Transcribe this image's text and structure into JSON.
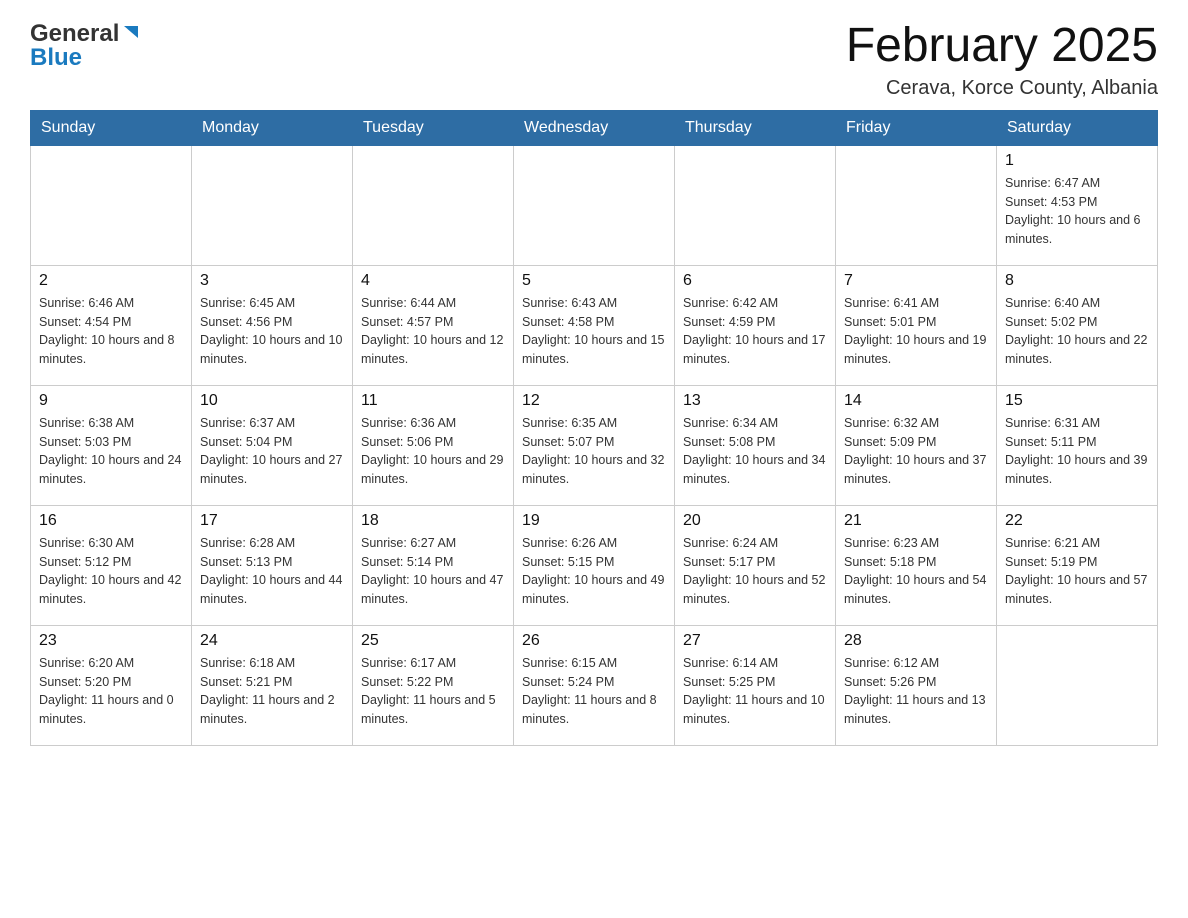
{
  "logo": {
    "general": "General",
    "blue": "Blue"
  },
  "title": "February 2025",
  "subtitle": "Cerava, Korce County, Albania",
  "days_of_week": [
    "Sunday",
    "Monday",
    "Tuesday",
    "Wednesday",
    "Thursday",
    "Friday",
    "Saturday"
  ],
  "weeks": [
    [
      {
        "day": "",
        "info": ""
      },
      {
        "day": "",
        "info": ""
      },
      {
        "day": "",
        "info": ""
      },
      {
        "day": "",
        "info": ""
      },
      {
        "day": "",
        "info": ""
      },
      {
        "day": "",
        "info": ""
      },
      {
        "day": "1",
        "info": "Sunrise: 6:47 AM\nSunset: 4:53 PM\nDaylight: 10 hours and 6 minutes."
      }
    ],
    [
      {
        "day": "2",
        "info": "Sunrise: 6:46 AM\nSunset: 4:54 PM\nDaylight: 10 hours and 8 minutes."
      },
      {
        "day": "3",
        "info": "Sunrise: 6:45 AM\nSunset: 4:56 PM\nDaylight: 10 hours and 10 minutes."
      },
      {
        "day": "4",
        "info": "Sunrise: 6:44 AM\nSunset: 4:57 PM\nDaylight: 10 hours and 12 minutes."
      },
      {
        "day": "5",
        "info": "Sunrise: 6:43 AM\nSunset: 4:58 PM\nDaylight: 10 hours and 15 minutes."
      },
      {
        "day": "6",
        "info": "Sunrise: 6:42 AM\nSunset: 4:59 PM\nDaylight: 10 hours and 17 minutes."
      },
      {
        "day": "7",
        "info": "Sunrise: 6:41 AM\nSunset: 5:01 PM\nDaylight: 10 hours and 19 minutes."
      },
      {
        "day": "8",
        "info": "Sunrise: 6:40 AM\nSunset: 5:02 PM\nDaylight: 10 hours and 22 minutes."
      }
    ],
    [
      {
        "day": "9",
        "info": "Sunrise: 6:38 AM\nSunset: 5:03 PM\nDaylight: 10 hours and 24 minutes."
      },
      {
        "day": "10",
        "info": "Sunrise: 6:37 AM\nSunset: 5:04 PM\nDaylight: 10 hours and 27 minutes."
      },
      {
        "day": "11",
        "info": "Sunrise: 6:36 AM\nSunset: 5:06 PM\nDaylight: 10 hours and 29 minutes."
      },
      {
        "day": "12",
        "info": "Sunrise: 6:35 AM\nSunset: 5:07 PM\nDaylight: 10 hours and 32 minutes."
      },
      {
        "day": "13",
        "info": "Sunrise: 6:34 AM\nSunset: 5:08 PM\nDaylight: 10 hours and 34 minutes."
      },
      {
        "day": "14",
        "info": "Sunrise: 6:32 AM\nSunset: 5:09 PM\nDaylight: 10 hours and 37 minutes."
      },
      {
        "day": "15",
        "info": "Sunrise: 6:31 AM\nSunset: 5:11 PM\nDaylight: 10 hours and 39 minutes."
      }
    ],
    [
      {
        "day": "16",
        "info": "Sunrise: 6:30 AM\nSunset: 5:12 PM\nDaylight: 10 hours and 42 minutes."
      },
      {
        "day": "17",
        "info": "Sunrise: 6:28 AM\nSunset: 5:13 PM\nDaylight: 10 hours and 44 minutes."
      },
      {
        "day": "18",
        "info": "Sunrise: 6:27 AM\nSunset: 5:14 PM\nDaylight: 10 hours and 47 minutes."
      },
      {
        "day": "19",
        "info": "Sunrise: 6:26 AM\nSunset: 5:15 PM\nDaylight: 10 hours and 49 minutes."
      },
      {
        "day": "20",
        "info": "Sunrise: 6:24 AM\nSunset: 5:17 PM\nDaylight: 10 hours and 52 minutes."
      },
      {
        "day": "21",
        "info": "Sunrise: 6:23 AM\nSunset: 5:18 PM\nDaylight: 10 hours and 54 minutes."
      },
      {
        "day": "22",
        "info": "Sunrise: 6:21 AM\nSunset: 5:19 PM\nDaylight: 10 hours and 57 minutes."
      }
    ],
    [
      {
        "day": "23",
        "info": "Sunrise: 6:20 AM\nSunset: 5:20 PM\nDaylight: 11 hours and 0 minutes."
      },
      {
        "day": "24",
        "info": "Sunrise: 6:18 AM\nSunset: 5:21 PM\nDaylight: 11 hours and 2 minutes."
      },
      {
        "day": "25",
        "info": "Sunrise: 6:17 AM\nSunset: 5:22 PM\nDaylight: 11 hours and 5 minutes."
      },
      {
        "day": "26",
        "info": "Sunrise: 6:15 AM\nSunset: 5:24 PM\nDaylight: 11 hours and 8 minutes."
      },
      {
        "day": "27",
        "info": "Sunrise: 6:14 AM\nSunset: 5:25 PM\nDaylight: 11 hours and 10 minutes."
      },
      {
        "day": "28",
        "info": "Sunrise: 6:12 AM\nSunset: 5:26 PM\nDaylight: 11 hours and 13 minutes."
      },
      {
        "day": "",
        "info": ""
      }
    ]
  ]
}
